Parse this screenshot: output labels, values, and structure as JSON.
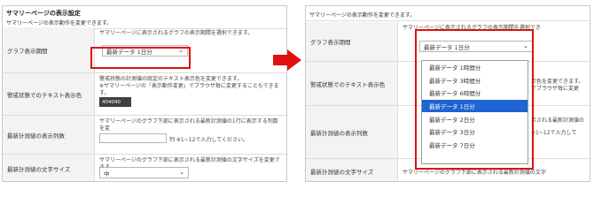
{
  "left_panel": {
    "title": "サマリーページの表示設定",
    "subtitle": "サマリーページの表示動作を変更できます。",
    "rows": [
      {
        "label": "グラフ表示期間",
        "description": "サマリーページに表示されるグラフの表示期間を選択できます。",
        "select_value": "最新データ 1日分"
      },
      {
        "label": "警戒状態でのテキスト表示色",
        "description": "警戒状態の計測値の既定のテキスト表示色を変更できます。",
        "description2": "※サマリーページの「表示動作変更」でブラウザ毎に変更することもできます。",
        "color_value": "404040"
      },
      {
        "label": "最新計測値の表示列数",
        "description": "サマリーページのグラフ下部に表示される最新計測値の1行に表示する列数を変",
        "input_suffix": "列 ※1~12で入力してください。"
      },
      {
        "label": "最新計測値の文字サイズ",
        "description": "サマリーページのグラフ下部に表示される最新計測値の文字サイズを変更できま",
        "select_value": "中"
      }
    ]
  },
  "right_panel": {
    "subtitle": "サマリーページの表示動作を変更できます。",
    "rows": [
      {
        "label": "グラフ表示期間",
        "description": "サマリーページに表示されるグラフの表示期間を選択でき",
        "select_value": "最新データ 1日分"
      },
      {
        "label": "警戒状態でのテキスト表示色",
        "description_a": "示色を変更できます。",
        "description_b": "でブラウザ毎に変更"
      },
      {
        "label": "最新計測値の表示列数",
        "description_a": "示される最新計測値の",
        "description_b": "※1~12で入力して"
      },
      {
        "label": "最新計測値の文字サイズ",
        "description": "サマリーページのグラフ下部に表示される最新計測値の文字"
      }
    ],
    "dropdown_options": [
      "最新データ 1時間分",
      "最新データ 3時間分",
      "最新データ 6時間分",
      "最新データ 1日分",
      "最新データ 2日分",
      "最新データ 3日分",
      "最新データ 7日分"
    ],
    "selected_index": 3
  },
  "colors": {
    "highlight": "#e01010",
    "selected_option": "#1e64d2",
    "swatch": "#404040"
  }
}
